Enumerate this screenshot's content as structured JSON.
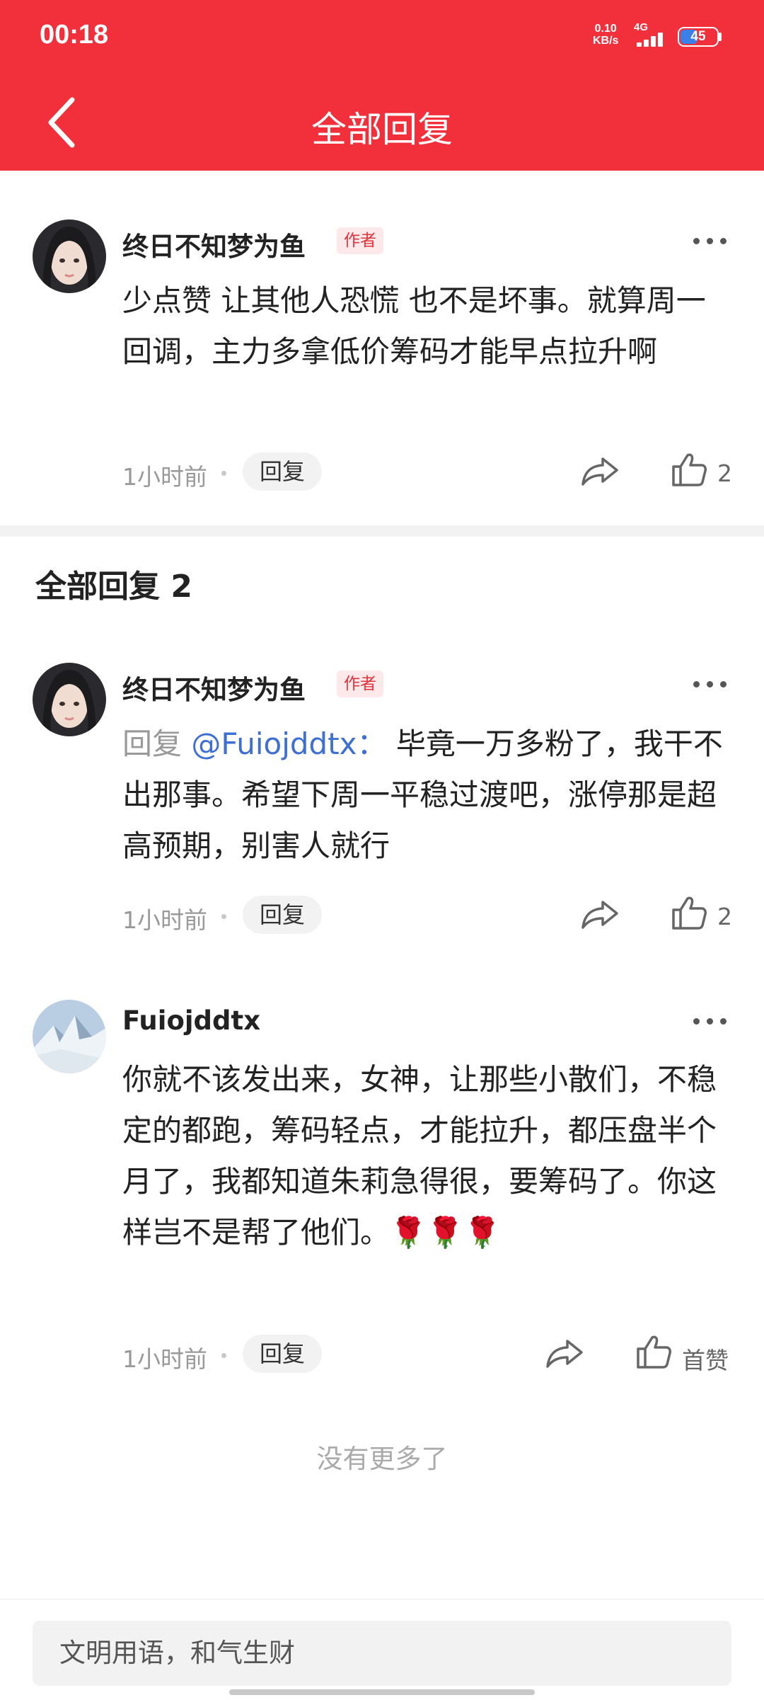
{
  "status_bar": {
    "time": "00:18",
    "net_speed": "0.10",
    "net_unit": "KB/s",
    "network": "4G",
    "battery": "45",
    "battery_color": "#3b7fe8"
  },
  "header": {
    "title": "全部回复",
    "back_icon": "chevron-left-icon",
    "bg_color": "#f1303b"
  },
  "main_comment": {
    "author": "终日不知梦为鱼",
    "badge": "作者",
    "text": "少点赞 让其他人恐慌 也不是坏事。就算周一回调，主力多拿低价筹码才能早点拉升啊",
    "time": "1小时前",
    "reply_label": "回复",
    "likes": "2"
  },
  "section_title": "全部回复 2",
  "replies": [
    {
      "author": "终日不知梦为鱼",
      "badge": "作者",
      "reply_prefix": "回复",
      "reply_to": "@Fuiojddtx：",
      "text": "毕竟一万多粉了，我干不出那事。希望下周一平稳过渡吧，涨停那是超高预期，别害人就行",
      "time": "1小时前",
      "reply_label": "回复",
      "likes": "2"
    },
    {
      "author": "Fuiojddtx",
      "text": "你就不该发出来，女神，让那些小散们，不稳定的都跑，筹码轻点，才能拉升，都压盘半个月了，我都知道朱莉急得很，要筹码了。你这样岂不是帮了他们。🌹🌹🌹",
      "time": "1小时前",
      "reply_label": "回复",
      "likes": "首赞"
    }
  ],
  "no_more": "没有更多了",
  "input": {
    "placeholder": "文明用语，和气生财"
  }
}
